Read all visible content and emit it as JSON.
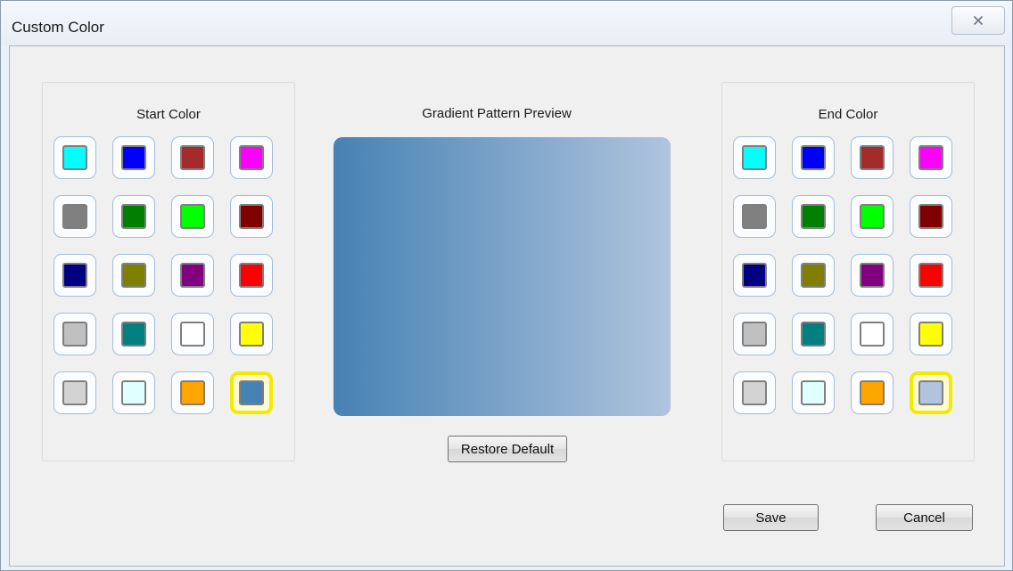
{
  "window": {
    "title": "Custom Color",
    "close_icon": "close-x-icon"
  },
  "start_color": {
    "label": "Start Color",
    "swatches": [
      "#00ffff",
      "#0000ff",
      "#a52a2a",
      "#ff00ff",
      "#808080",
      "#008000",
      "#00ff00",
      "#800000",
      "#000080",
      "#808000",
      "#800080",
      "#ff0000",
      "#c0c0c0",
      "#008080",
      "#ffffff",
      "#ffff00",
      "#d3d3d3",
      "#e0ffff",
      "#ffa500",
      "#4682b4"
    ],
    "selected_index": 19
  },
  "end_color": {
    "label": "End Color",
    "swatches": [
      "#00ffff",
      "#0000ff",
      "#a52a2a",
      "#ff00ff",
      "#808080",
      "#008000",
      "#00ff00",
      "#800000",
      "#000080",
      "#808000",
      "#800080",
      "#ff0000",
      "#c0c0c0",
      "#008080",
      "#ffffff",
      "#ffff00",
      "#d3d3d3",
      "#e0ffff",
      "#ffa500",
      "#b0c4de"
    ],
    "selected_index": 19
  },
  "preview": {
    "label": "Gradient Pattern Preview",
    "start": "#4682b4",
    "end": "#b0c4de"
  },
  "buttons": {
    "restore": "Restore Default",
    "save": "Save",
    "cancel": "Cancel"
  },
  "colors": {
    "selection_highlight": "#f3ea00",
    "swatch_ring": "#a6bcd6"
  }
}
